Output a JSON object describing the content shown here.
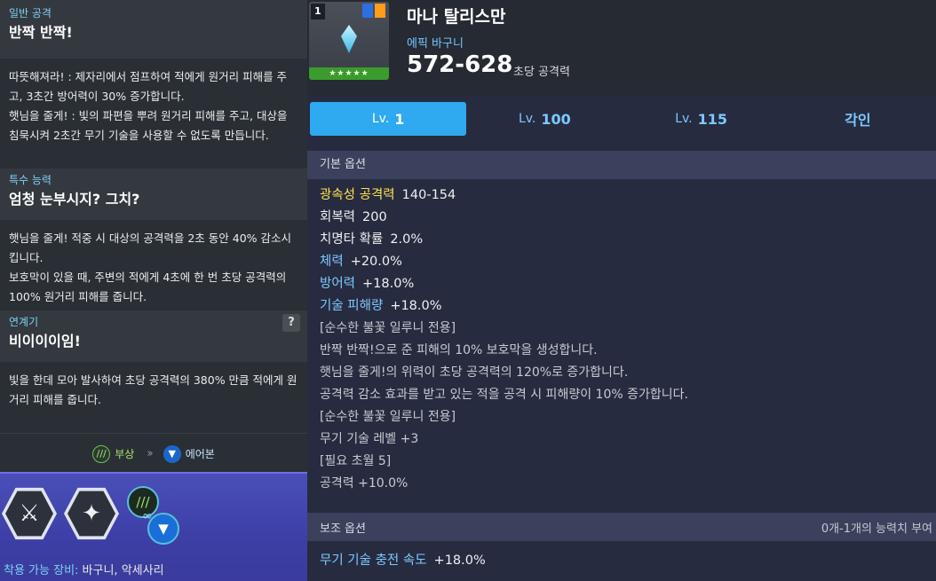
{
  "left": {
    "sections": [
      {
        "category": "일반 공격",
        "title": "반짝 반짝!",
        "lines": [
          "따뜻해져라! : 제자리에서 점프하여 적에게 원거리 피해를 주고, 3초간 방어력이 30% 증가합니다.",
          "햇님을 줄게! : 빛의 파편을 뿌려 원거리 피해를 주고, 대상을 침묵시켜 2초간 무기 기술을 사용할 수 없도록 만듭니다."
        ]
      },
      {
        "category": "특수 능력",
        "title": "엄청 눈부시지? 그치?",
        "lines": [
          "햇님을 줄게! 적중 시 대상의 공격력을 2초 동안 40% 감소시킵니다.",
          "보호막이 있을 때, 주변의 적에게 4초에 한 번 초당 공격력의 100% 원거리 피해를 줍니다."
        ]
      },
      {
        "category": "연계기",
        "title": "비이이이임!",
        "help": "?",
        "lines": [
          "빛을 한데 모아 발사하여 초당 공격력의 380% 만큼 적에게 원거리 피해를 줍니다."
        ]
      }
    ],
    "chain": {
      "from": "부상",
      "to": "에어본"
    },
    "equip_label": "착용 가능 장비:",
    "equip_value": "바구니, 악세사리"
  },
  "item": {
    "count": "1",
    "name": "마나 탈리스만",
    "grade": "에픽 바구니",
    "attack": "572-628",
    "attack_label": "초당 공격력",
    "stars": "★★★★★"
  },
  "tabs": [
    {
      "lv": "Lv.",
      "num": "1",
      "active": true
    },
    {
      "lv": "Lv.",
      "num": "100",
      "active": false
    },
    {
      "lv": "Lv.",
      "num": "115",
      "active": false
    },
    {
      "lv": "",
      "num": "각인",
      "active": false
    }
  ],
  "basic": {
    "header": "기본 옵션",
    "options": [
      {
        "key": "광속성 공격력",
        "value": "140-154",
        "color": "#ffe24a"
      },
      {
        "key": "회복력",
        "value": "200",
        "color": "#f0f0f0"
      },
      {
        "key": "치명타 확률",
        "value": "2.0%",
        "color": "#f0f0f0"
      },
      {
        "key": "체력",
        "value": "+20.0%",
        "color": "#7ec8ff"
      },
      {
        "key": "방어력",
        "value": "+18.0%",
        "color": "#7ec8ff"
      },
      {
        "key": "기술 피해량",
        "value": "+18.0%",
        "color": "#7ec8ff"
      }
    ],
    "notes": [
      "[순수한 불꽃 일루니 전용]",
      "반짝 반짝!으로 준 피해의 10% 보호막을 생성합니다.",
      "햇님을 줄게!의 위력이 초당 공격력의 120%로 증가합니다.",
      "공격력 감소 효과를 받고 있는 적을 공격 시 피해량이 10% 증가합니다.",
      "[순수한 불꽃 일루니 전용]",
      "무기 기술 레벨 +3",
      "[필요 초월 5]",
      "공격력 +10.0%"
    ]
  },
  "sub": {
    "header": "보조 옵션",
    "note": "0개-1개의 능력치 부여",
    "options": [
      {
        "key": "무기 기술 충전 속도",
        "value": "+18.0%",
        "color": "#7ec8ff"
      }
    ]
  }
}
